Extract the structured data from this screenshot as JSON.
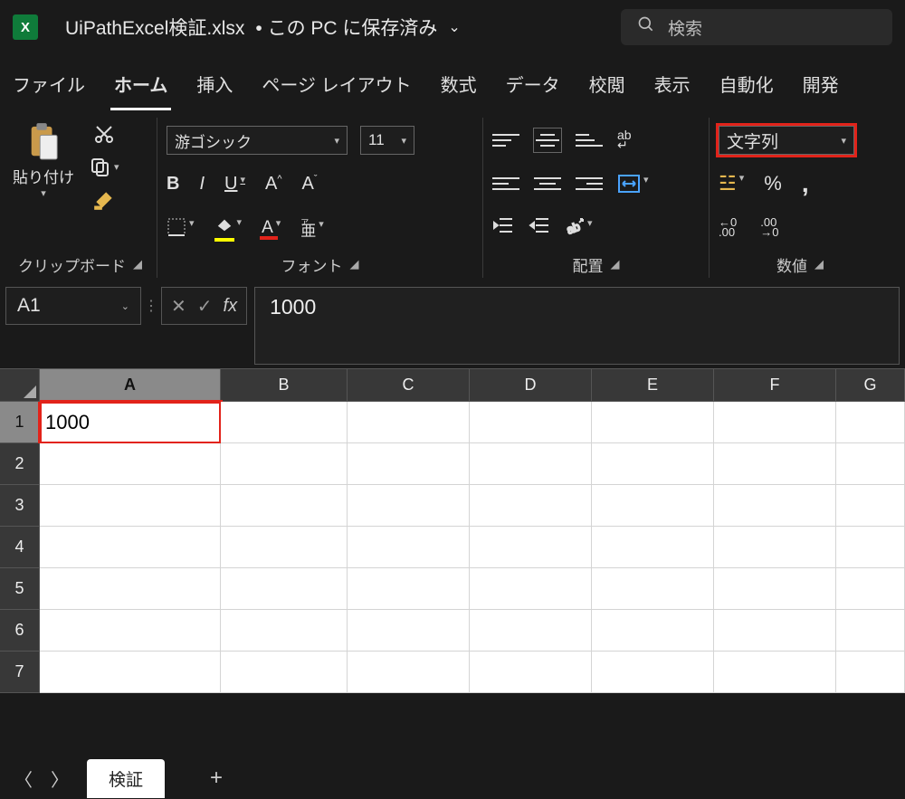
{
  "title": {
    "app_initial": "X",
    "filename": "UiPathExcel検証.xlsx",
    "save_state": "• この PC に保存済み"
  },
  "search": {
    "placeholder": "検索"
  },
  "tabs": {
    "file": "ファイル",
    "home": "ホーム",
    "insert": "挿入",
    "layout": "ページ レイアウト",
    "formulas": "数式",
    "data": "データ",
    "review": "校閲",
    "view": "表示",
    "automate": "自動化",
    "developer": "開発"
  },
  "clipboard": {
    "paste": "貼り付け",
    "label": "クリップボード"
  },
  "font": {
    "name": "游ゴシック",
    "size": "11",
    "bold": "B",
    "italic": "I",
    "underline": "U",
    "label": "フォント",
    "letter_A": "A"
  },
  "align": {
    "label": "配置",
    "wrap": "ab",
    "merge_icon": "⇔"
  },
  "number": {
    "format": "文字列",
    "label": "数値",
    "percent": "%",
    "comma": ",",
    "dec_inc": ".00",
    "dec_dec": ".00",
    "currency": "☳"
  },
  "formula_bar": {
    "cell_ref": "A1",
    "value": "1000",
    "fx": "fx",
    "cancel": "✕",
    "enter": "✓"
  },
  "grid": {
    "columns": [
      "A",
      "B",
      "C",
      "D",
      "E",
      "F",
      "G"
    ],
    "rows": [
      1,
      2,
      3,
      4,
      5,
      6,
      7
    ],
    "cells": {
      "A1": "1000"
    },
    "selected": "A1"
  },
  "sheetbar": {
    "prev": "〈",
    "next": "〉",
    "active_sheet": "検証",
    "add": "+"
  }
}
